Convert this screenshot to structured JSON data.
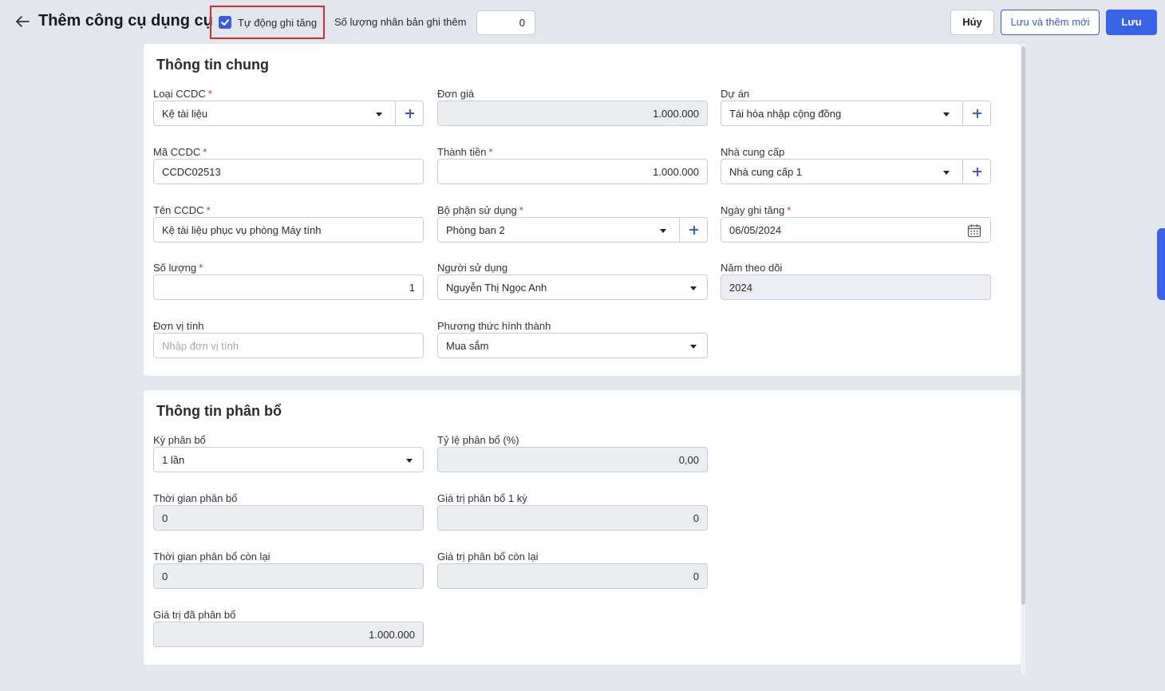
{
  "header": {
    "title": "Thêm công cụ dụng cụ",
    "auto_increase_label": "Tự động ghi tăng",
    "auto_increase_checked": true,
    "duplicate_label": "Số lượng nhân bản ghi thêm",
    "duplicate_value": "0",
    "cancel_label": "Hủy",
    "save_new_label": "Lưu và thêm mới",
    "save_label": "Lưu"
  },
  "general": {
    "title": "Thông tin chung",
    "loai_ccdc": {
      "label": "Loại CCDC",
      "value": "Kệ tài liệu"
    },
    "don_gia": {
      "label": "Đơn giá",
      "value": "1.000.000"
    },
    "du_an": {
      "label": "Dự án",
      "value": "Tái hòa nhập cộng đồng"
    },
    "ma_ccdc": {
      "label": "Mã CCDC",
      "value": "CCDC02513"
    },
    "thanh_tien": {
      "label": "Thành tiền",
      "value": "1.000.000"
    },
    "nha_cung_cap": {
      "label": "Nhà cung cấp",
      "value": "Nhà cung cấp 1"
    },
    "ten_ccdc": {
      "label": "Tên CCDC",
      "value": "Kệ tài liệu phục vụ phòng Máy tính"
    },
    "bo_phan": {
      "label": "Bộ phận sử dụng",
      "value": "Phòng ban 2"
    },
    "ngay_ghi_tang": {
      "label": "Ngày ghi tăng",
      "value": "06/05/2024"
    },
    "so_luong": {
      "label": "Số lượng",
      "value": "1"
    },
    "nguoi_su_dung": {
      "label": "Người sử dụng",
      "value": "Nguyễn Thị Ngọc Anh"
    },
    "nam_theo_doi": {
      "label": "Năm theo dõi",
      "value": "2024"
    },
    "don_vi_tinh": {
      "label": "Đơn vị tính",
      "placeholder": "Nhập đơn vị tính"
    },
    "phuong_thuc": {
      "label": "Phương thức hình thành",
      "value": "Mua sắm"
    }
  },
  "allocation": {
    "title": "Thông tin phân bổ",
    "ky_phan_bo": {
      "label": "Kỳ phân bổ",
      "value": "1 lần"
    },
    "ty_le": {
      "label": "Tỷ lệ phân bổ (%)",
      "value": "0,00"
    },
    "thoi_gian": {
      "label": "Thời gian phân bổ",
      "value": "0"
    },
    "gia_tri_1_ky": {
      "label": "Giá trị phân bổ 1 kỳ",
      "value": "0"
    },
    "thoi_gian_con_lai": {
      "label": "Thời gian phân bổ còn lại",
      "value": "0"
    },
    "gia_tri_con_lai": {
      "label": "Giá trị phân bổ còn lại",
      "value": "0"
    },
    "gia_tri_da_phan_bo": {
      "label": "Giá trị đã phân bổ",
      "value": "1.000.000"
    }
  },
  "required_mark": "*",
  "colors": {
    "accent": "#3b63e8",
    "required": "#d32f2f",
    "highlight_border": "#d32f2f"
  }
}
